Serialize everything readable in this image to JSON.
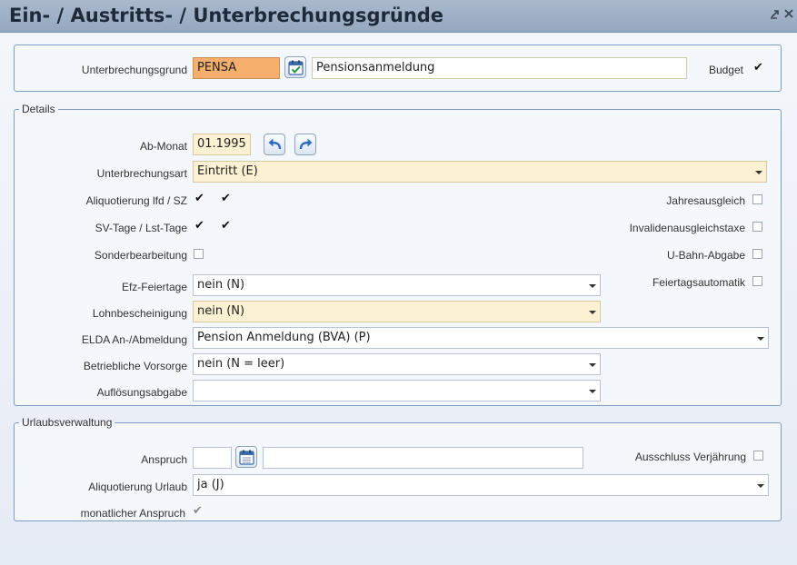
{
  "window": {
    "title": "Ein- / Austritts- / Unterbrechungsgründe"
  },
  "top": {
    "unterbrechungsgrund_label": "Unterbrechungsgrund",
    "code_value": "PENSA",
    "description_value": "Pensionsanmeldung",
    "budget_label": "Budget",
    "budget_checked": true
  },
  "details": {
    "legend": "Details",
    "ab_monat_label": "Ab-Monat",
    "ab_monat_value": "01.1995",
    "unterbrechungsart_label": "Unterbrechungsart",
    "unterbrechungsart_value": "Eintritt (E)",
    "aliquotierung_label": "Aliquotierung lfd / SZ",
    "aliquotierung_lfd": true,
    "aliquotierung_sz": true,
    "svtage_label": "SV-Tage / Lst-Tage",
    "sv_tage": true,
    "lst_tage": true,
    "sonderbearbeitung_label": "Sonderbearbeitung",
    "sonderbearbeitung": false,
    "jahresausgleich_label": "Jahresausgleich",
    "jahresausgleich": false,
    "invalidenausgleichstaxe_label": "Invalidenausgleichstaxe",
    "invalidenausgleichstaxe": false,
    "ubahn_label": "U-Bahn-Abgabe",
    "ubahn": false,
    "feiertagsautomatik_label": "Feiertagsautomatik",
    "feiertagsautomatik": false,
    "efz_label": "Efz-Feiertage",
    "efz_value": "nein (N)",
    "lohnbescheinigung_label": "Lohnbescheinigung",
    "lohnbescheinigung_value": "nein (N)",
    "elda_label": "ELDA An-/Abmeldung",
    "elda_value": "Pension Anmeldung (BVA) (P)",
    "vorsorge_label": "Betriebliche Vorsorge",
    "vorsorge_value": "nein (N = leer)",
    "aufloesung_label": "Auflösungsabgabe",
    "aufloesung_value": ""
  },
  "urlaub": {
    "legend": "Urlaubsverwaltung",
    "anspruch_label": "Anspruch",
    "anspruch_code": "",
    "anspruch_text": "",
    "ausschluss_label": "Ausschluss Verjährung",
    "ausschluss": false,
    "aliquotierung_label": "Aliquotierung Urlaub",
    "aliquotierung_value": "ja (J)",
    "monatlicher_label": "monatlicher Anspruch",
    "monatlicher": true
  },
  "colors": {
    "titlebar": "#95a8bf",
    "highlight_orange": "#f5ae6b",
    "highlight_yellow": "#fdf1d4",
    "border_blue": "#7f9cc3"
  },
  "icons": {
    "calendar_check": "calendar-check-icon",
    "undo": "undo-arrow-icon",
    "redo": "redo-arrow-icon",
    "calendar": "calendar-icon",
    "minimize": "minimize-icon",
    "close": "close-icon"
  }
}
